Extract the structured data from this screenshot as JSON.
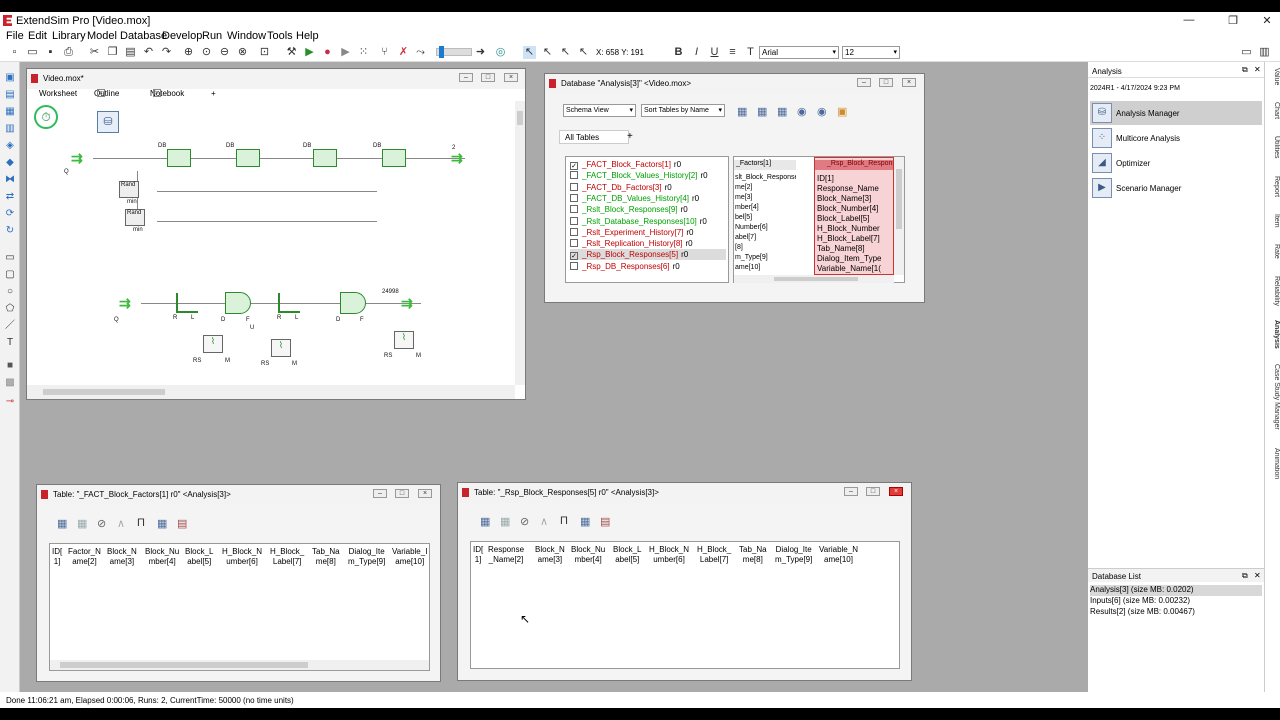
{
  "app": {
    "title": "ExtendSim Pro  [Video.mox]"
  },
  "menu": [
    "File",
    "Edit",
    "Library",
    "Model",
    "Database",
    "Develop",
    "Run",
    "Window",
    "Tools",
    "Help"
  ],
  "toolbar": {
    "coords": "X: 658 Y: 191",
    "font": "Arial",
    "size": "12"
  },
  "model_window": {
    "title": "Video.mox*",
    "tabs": [
      "Worksheet",
      "Outline",
      "Notebook"
    ],
    "labels": {
      "db": "DB",
      "rand": "Rand",
      "min": "min",
      "two": "2",
      "q": "Q",
      "count": "24998",
      "r": "R",
      "l": "L",
      "d": "D",
      "f": "F",
      "u": "U",
      "rs": "RS",
      "m": "M"
    }
  },
  "db_window": {
    "title": "Database \"Analysis[3]\" <Video.mox>",
    "view": "Schema View",
    "sort": "Sort Tables by Name",
    "tab": "All Tables",
    "tables": [
      {
        "name": "_FACT_Block_Factors[1]",
        "r": "r0",
        "checked": true,
        "color": "#c00000"
      },
      {
        "name": "_FACT_Block_Values_History[2]",
        "r": "r0",
        "checked": false,
        "color": "#00a000"
      },
      {
        "name": "_FACT_Db_Factors[3]",
        "r": "r0",
        "checked": false,
        "color": "#c00000"
      },
      {
        "name": "_FACT_DB_Values_History[4]",
        "r": "r0",
        "checked": false,
        "color": "#00a000"
      },
      {
        "name": "_Rslt_Block_Responses[9]",
        "r": "r0",
        "checked": false,
        "color": "#00a000"
      },
      {
        "name": "_Rslt_Database_Responses[10]",
        "r": "r0",
        "checked": false,
        "color": "#00a000"
      },
      {
        "name": "_Rslt_Experiment_History[7]",
        "r": "r0",
        "checked": false,
        "color": "#c00000"
      },
      {
        "name": "_Rslt_Replication_History[8]",
        "r": "r0",
        "checked": false,
        "color": "#c00000"
      },
      {
        "name": "_Rsp_Block_Responses[5]",
        "r": "r0",
        "checked": true,
        "color": "#c00000"
      },
      {
        "name": "_Rsp_DB_Responses[6]",
        "r": "r0",
        "checked": false,
        "color": "#c00000"
      }
    ],
    "factors_box": {
      "title": "_Factors[1]",
      "fields": [
        "slt_Block_Responses",
        "me[2]",
        "me[3]",
        "mber[4]",
        "bel[5]",
        "Number[6]",
        "abel[7]",
        "[8]",
        "m_Type[9]",
        "ame[10]"
      ]
    },
    "rsp_box": {
      "title": "_Rsp_Block_Respons",
      "fields": [
        "ID[1]",
        "Response_Name",
        "Block_Name[3]",
        "Block_Number[4]",
        "Block_Label[5]",
        "H_Block_Number",
        "H_Block_Label[7]",
        "Tab_Name[8]",
        "Dialog_Item_Type",
        "Variable_Name[1("
      ]
    }
  },
  "factors_table": {
    "title": "Table: \"_FACT_Block_Factors[1]  r0\" <Analysis[3]>",
    "headers": [
      "ID[\n1]",
      "Factor_N\name[2]",
      "Block_N\name[3]",
      "Block_Nu\nmber[4]",
      "Block_L\nabel[5]",
      "H_Block_N\number[6]",
      "H_Block_\nLabel[7]",
      "Tab_Na\nme[8]",
      "Dialog_Ite\nm_Type[9]",
      "Variable_I\name[10]"
    ]
  },
  "rsp_table": {
    "title": "Table: \"_Rsp_Block_Responses[5]  r0\" <Analysis[3]>",
    "headers": [
      "ID[\n1]",
      "Response\n_Name[2]",
      "Block_N\name[3]",
      "Block_Nu\nmber[4]",
      "Block_L\nabel[5]",
      "H_Block_N\number[6]",
      "H_Block_\nLabel[7]",
      "Tab_Na\nme[8]",
      "Dialog_Ite\nm_Type[9]",
      "Variable_N\name[10]"
    ]
  },
  "analysis_panel": {
    "title": "Analysis",
    "version": "2024R1 - 4/17/2024 9:23 PM",
    "items": [
      "Analysis Manager",
      "Multicore Analysis",
      "Optimizer",
      "Scenario Manager"
    ]
  },
  "db_list": {
    "title": "Database List",
    "items": [
      "Analysis[3]  (size MB: 0.0202)",
      "Inputs[6]  (size MB: 0.00232)",
      "Results[2]  (size MB: 0.00467)"
    ]
  },
  "side_tabs": [
    "Value",
    "Chart",
    "Utilities",
    "Report",
    "Item",
    "Rate",
    "Reliability",
    "Analysis",
    "Case Study Manager",
    "Animation"
  ],
  "status": "Done 11:06:21 am, Elapsed 0:00:06, Runs: 2, CurrentTime: 50000 (no time units)"
}
